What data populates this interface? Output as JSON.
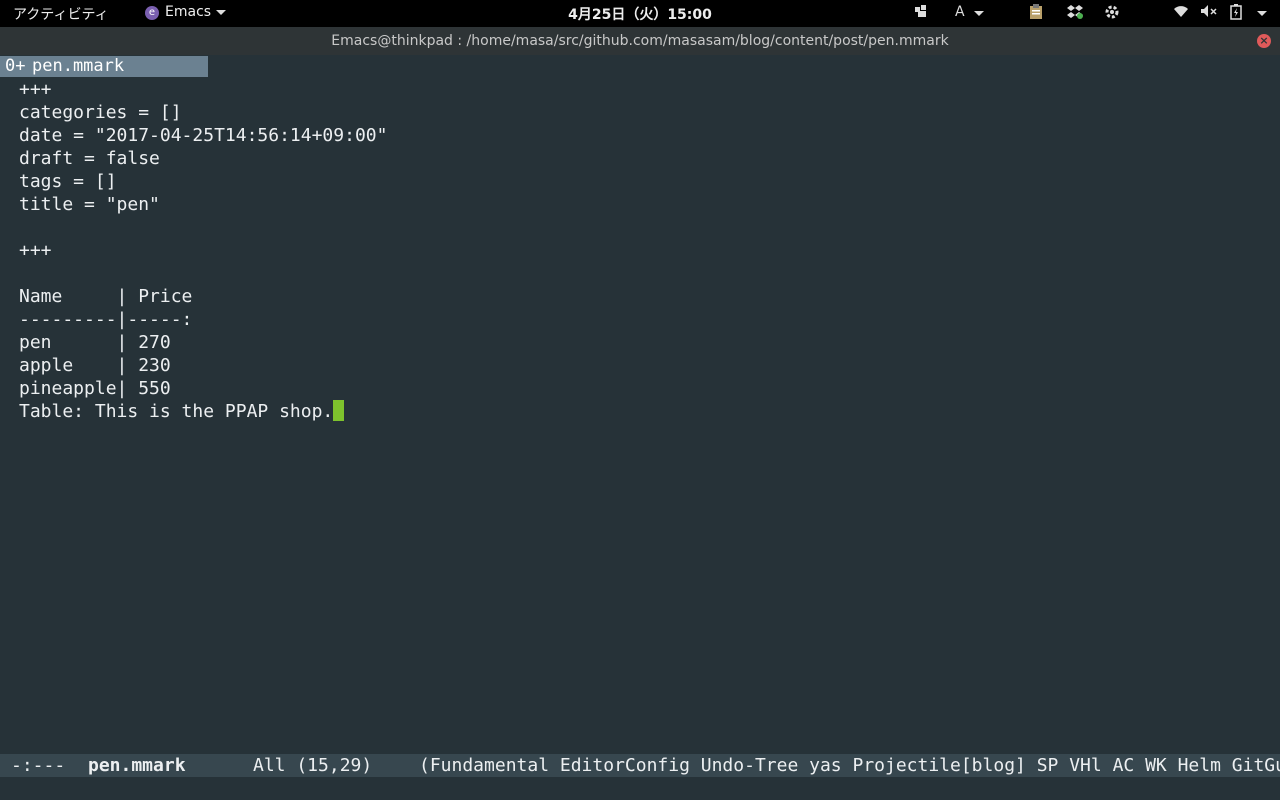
{
  "topbar": {
    "activities": "アクティビティ",
    "app_name": "Emacs",
    "clock": "4月25日（火）15:00",
    "input_method": "A"
  },
  "window": {
    "title": "Emacs@thinkpad : /home/masa/src/github.com/masasam/blog/content/post/pen.mmark"
  },
  "tab": {
    "number": "0+",
    "name": "pen.mmark"
  },
  "buffer": {
    "lines": [
      "+++",
      "categories = []",
      "date = \"2017-04-25T14:56:14+09:00\"",
      "draft = false",
      "tags = []",
      "title = \"pen\"",
      "",
      "+++",
      "",
      "Name     | Price",
      "---------|-----:",
      "pen      | 270",
      "apple    | 230",
      "pineapple| 550",
      "Table: This is the PPAP shop."
    ]
  },
  "modeline": {
    "status": "-:---",
    "buffer_name": "pen.mmark",
    "position": "All (15,29)",
    "modes": "(Fundamental EditorConfig Undo-Tree yas Projectile[blog] SP VHl AC WK Helm GitGutter)"
  },
  "colors": {
    "background": "#263238",
    "cursor": "#7ec22d",
    "tab_active": "#6b8191",
    "modeline": "#37474f"
  }
}
